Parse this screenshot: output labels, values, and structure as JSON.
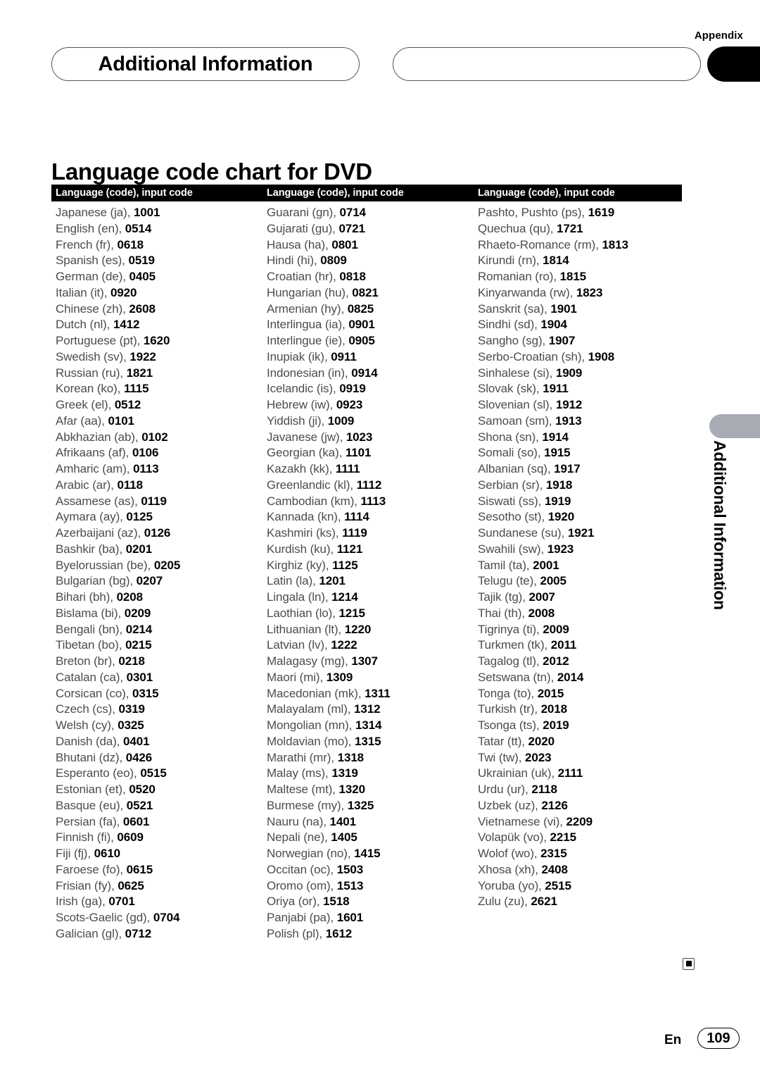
{
  "header": {
    "appendix_label": "Appendix",
    "chapter_title": "Additional Information",
    "side_tab_text": "Additional Information"
  },
  "page_title": "Language code chart for DVD",
  "table": {
    "column_headers": [
      "Language (code), input code",
      "Language (code), input code",
      "Language (code), input code"
    ],
    "columns": [
      [
        {
          "name": "Japanese (ja), ",
          "code": "1001"
        },
        {
          "name": "English (en), ",
          "code": "0514"
        },
        {
          "name": "French (fr), ",
          "code": "0618"
        },
        {
          "name": "Spanish (es), ",
          "code": "0519"
        },
        {
          "name": "German (de), ",
          "code": "0405"
        },
        {
          "name": "Italian (it), ",
          "code": "0920"
        },
        {
          "name": "Chinese (zh), ",
          "code": "2608"
        },
        {
          "name": "Dutch (nl), ",
          "code": "1412"
        },
        {
          "name": "Portuguese (pt), ",
          "code": "1620"
        },
        {
          "name": "Swedish (sv), ",
          "code": "1922"
        },
        {
          "name": "Russian (ru), ",
          "code": "1821"
        },
        {
          "name": "Korean (ko), ",
          "code": "1115"
        },
        {
          "name": "Greek (el), ",
          "code": "0512"
        },
        {
          "name": "Afar (aa), ",
          "code": "0101"
        },
        {
          "name": "Abkhazian (ab), ",
          "code": "0102"
        },
        {
          "name": "Afrikaans (af), ",
          "code": "0106"
        },
        {
          "name": "Amharic (am), ",
          "code": "0113"
        },
        {
          "name": "Arabic (ar), ",
          "code": "0118"
        },
        {
          "name": "Assamese (as), ",
          "code": "0119"
        },
        {
          "name": "Aymara (ay), ",
          "code": "0125"
        },
        {
          "name": "Azerbaijani (az), ",
          "code": "0126"
        },
        {
          "name": "Bashkir (ba), ",
          "code": "0201"
        },
        {
          "name": "Byelorussian (be), ",
          "code": "0205"
        },
        {
          "name": "Bulgarian (bg), ",
          "code": "0207"
        },
        {
          "name": "Bihari (bh), ",
          "code": "0208"
        },
        {
          "name": "Bislama (bi), ",
          "code": "0209"
        },
        {
          "name": "Bengali (bn), ",
          "code": "0214"
        },
        {
          "name": "Tibetan (bo), ",
          "code": "0215"
        },
        {
          "name": "Breton (br), ",
          "code": "0218"
        },
        {
          "name": "Catalan (ca), ",
          "code": "0301"
        },
        {
          "name": "Corsican (co), ",
          "code": "0315"
        },
        {
          "name": "Czech (cs), ",
          "code": "0319"
        },
        {
          "name": "Welsh (cy), ",
          "code": "0325"
        },
        {
          "name": "Danish (da), ",
          "code": "0401"
        },
        {
          "name": "Bhutani (dz), ",
          "code": "0426"
        },
        {
          "name": "Esperanto (eo), ",
          "code": "0515"
        },
        {
          "name": "Estonian (et), ",
          "code": "0520"
        },
        {
          "name": "Basque (eu), ",
          "code": "0521"
        },
        {
          "name": "Persian (fa), ",
          "code": "0601"
        },
        {
          "name": "Finnish (fi), ",
          "code": "0609"
        },
        {
          "name": "Fiji (fj), ",
          "code": "0610"
        },
        {
          "name": "Faroese (fo), ",
          "code": "0615"
        },
        {
          "name": "Frisian (fy), ",
          "code": "0625"
        },
        {
          "name": "Irish (ga), ",
          "code": "0701"
        },
        {
          "name": "Scots-Gaelic (gd), ",
          "code": "0704"
        },
        {
          "name": "Galician (gl), ",
          "code": "0712"
        }
      ],
      [
        {
          "name": "Guarani (gn), ",
          "code": "0714"
        },
        {
          "name": "Gujarati (gu), ",
          "code": "0721"
        },
        {
          "name": "Hausa (ha), ",
          "code": "0801"
        },
        {
          "name": "Hindi (hi), ",
          "code": "0809"
        },
        {
          "name": "Croatian (hr), ",
          "code": "0818"
        },
        {
          "name": "Hungarian (hu), ",
          "code": "0821"
        },
        {
          "name": "Armenian (hy), ",
          "code": "0825"
        },
        {
          "name": "Interlingua (ia), ",
          "code": "0901"
        },
        {
          "name": "Interlingue (ie), ",
          "code": "0905"
        },
        {
          "name": "Inupiak (ik), ",
          "code": "0911"
        },
        {
          "name": "Indonesian (in), ",
          "code": "0914"
        },
        {
          "name": "Icelandic (is), ",
          "code": "0919"
        },
        {
          "name": "Hebrew (iw), ",
          "code": "0923"
        },
        {
          "name": "Yiddish (ji), ",
          "code": "1009"
        },
        {
          "name": "Javanese (jw), ",
          "code": "1023"
        },
        {
          "name": "Georgian (ka), ",
          "code": "1101"
        },
        {
          "name": "Kazakh (kk), ",
          "code": "1111"
        },
        {
          "name": "Greenlandic (kl), ",
          "code": "1112"
        },
        {
          "name": "Cambodian (km), ",
          "code": "1113"
        },
        {
          "name": "Kannada (kn), ",
          "code": "1114"
        },
        {
          "name": "Kashmiri (ks), ",
          "code": "1119"
        },
        {
          "name": "Kurdish (ku), ",
          "code": "1121"
        },
        {
          "name": "Kirghiz (ky), ",
          "code": "1125"
        },
        {
          "name": "Latin (la), ",
          "code": "1201"
        },
        {
          "name": "Lingala (ln), ",
          "code": "1214"
        },
        {
          "name": "Laothian (lo), ",
          "code": "1215"
        },
        {
          "name": "Lithuanian (lt), ",
          "code": "1220"
        },
        {
          "name": "Latvian (lv), ",
          "code": "1222"
        },
        {
          "name": "Malagasy (mg), ",
          "code": "1307"
        },
        {
          "name": "Maori (mi), ",
          "code": "1309"
        },
        {
          "name": "Macedonian (mk), ",
          "code": "1311"
        },
        {
          "name": "Malayalam (ml), ",
          "code": "1312"
        },
        {
          "name": "Mongolian (mn), ",
          "code": "1314"
        },
        {
          "name": "Moldavian (mo), ",
          "code": "1315"
        },
        {
          "name": "Marathi (mr), ",
          "code": "1318"
        },
        {
          "name": "Malay (ms), ",
          "code": "1319"
        },
        {
          "name": "Maltese (mt), ",
          "code": "1320"
        },
        {
          "name": "Burmese (my), ",
          "code": "1325"
        },
        {
          "name": "Nauru (na), ",
          "code": "1401"
        },
        {
          "name": "Nepali (ne), ",
          "code": "1405"
        },
        {
          "name": "Norwegian (no), ",
          "code": "1415"
        },
        {
          "name": "Occitan (oc), ",
          "code": "1503"
        },
        {
          "name": "Oromo (om), ",
          "code": "1513"
        },
        {
          "name": "Oriya (or), ",
          "code": "1518"
        },
        {
          "name": "Panjabi (pa), ",
          "code": "1601"
        },
        {
          "name": "Polish (pl), ",
          "code": "1612"
        }
      ],
      [
        {
          "name": "Pashto, Pushto (ps), ",
          "code": "1619"
        },
        {
          "name": "Quechua (qu), ",
          "code": "1721"
        },
        {
          "name": "Rhaeto-Romance (rm), ",
          "code": "1813"
        },
        {
          "name": "Kirundi (rn), ",
          "code": "1814"
        },
        {
          "name": "Romanian (ro), ",
          "code": "1815"
        },
        {
          "name": "Kinyarwanda (rw), ",
          "code": "1823"
        },
        {
          "name": "Sanskrit (sa), ",
          "code": "1901"
        },
        {
          "name": "Sindhi (sd), ",
          "code": "1904"
        },
        {
          "name": "Sangho (sg), ",
          "code": "1907"
        },
        {
          "name": "Serbo-Croatian (sh), ",
          "code": "1908"
        },
        {
          "name": "Sinhalese (si), ",
          "code": "1909"
        },
        {
          "name": "Slovak (sk), ",
          "code": "1911"
        },
        {
          "name": "Slovenian (sl), ",
          "code": "1912"
        },
        {
          "name": "Samoan (sm), ",
          "code": "1913"
        },
        {
          "name": "Shona (sn), ",
          "code": "1914"
        },
        {
          "name": "Somali (so), ",
          "code": "1915"
        },
        {
          "name": "Albanian (sq), ",
          "code": "1917"
        },
        {
          "name": "Serbian (sr), ",
          "code": "1918"
        },
        {
          "name": "Siswati (ss), ",
          "code": "1919"
        },
        {
          "name": "Sesotho (st), ",
          "code": "1920"
        },
        {
          "name": "Sundanese (su), ",
          "code": "1921"
        },
        {
          "name": "Swahili (sw), ",
          "code": "1923"
        },
        {
          "name": "Tamil (ta), ",
          "code": "2001"
        },
        {
          "name": "Telugu (te), ",
          "code": "2005"
        },
        {
          "name": "Tajik (tg), ",
          "code": "2007"
        },
        {
          "name": "Thai (th), ",
          "code": "2008"
        },
        {
          "name": "Tigrinya (ti), ",
          "code": "2009"
        },
        {
          "name": "Turkmen (tk), ",
          "code": "2011"
        },
        {
          "name": "Tagalog (tl), ",
          "code": "2012"
        },
        {
          "name": "Setswana (tn), ",
          "code": "2014"
        },
        {
          "name": "Tonga (to), ",
          "code": "2015"
        },
        {
          "name": "Turkish (tr), ",
          "code": "2018"
        },
        {
          "name": "Tsonga (ts), ",
          "code": "2019"
        },
        {
          "name": "Tatar (tt), ",
          "code": "2020"
        },
        {
          "name": "Twi (tw), ",
          "code": "2023"
        },
        {
          "name": "Ukrainian (uk), ",
          "code": "2111"
        },
        {
          "name": "Urdu (ur), ",
          "code": "2118"
        },
        {
          "name": "Uzbek (uz), ",
          "code": "2126"
        },
        {
          "name": "Vietnamese (vi), ",
          "code": "2209"
        },
        {
          "name": "Volapük (vo), ",
          "code": "2215"
        },
        {
          "name": "Wolof (wo), ",
          "code": "2315"
        },
        {
          "name": "Xhosa (xh), ",
          "code": "2408"
        },
        {
          "name": "Yoruba (yo), ",
          "code": "2515"
        },
        {
          "name": "Zulu (zu), ",
          "code": "2621"
        }
      ]
    ]
  },
  "footer": {
    "language_code": "En",
    "page_number": "109"
  }
}
